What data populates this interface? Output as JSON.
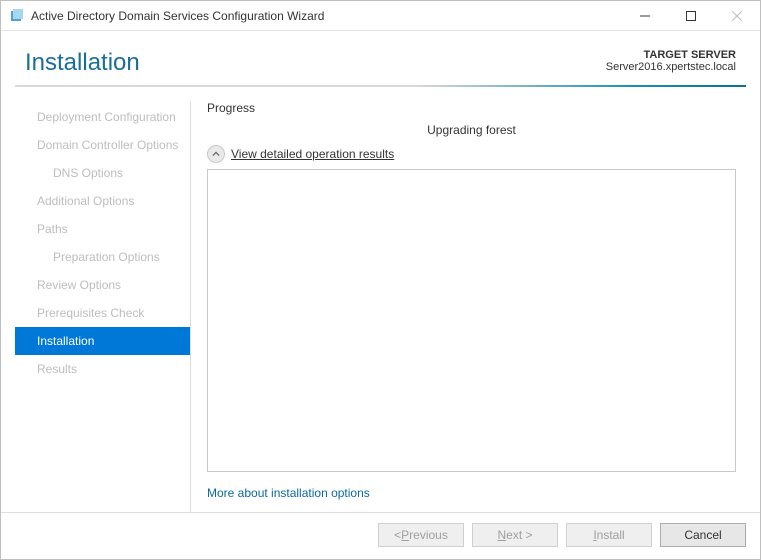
{
  "window": {
    "title": "Active Directory Domain Services Configuration Wizard"
  },
  "header": {
    "page_title": "Installation",
    "target_label": "TARGET SERVER",
    "target_value": "Server2016.xpertstec.local"
  },
  "sidebar": {
    "items": [
      {
        "label": "Deployment Configuration",
        "active": false
      },
      {
        "label": "Domain Controller Options",
        "active": false
      },
      {
        "label": "DNS Options",
        "active": false,
        "sub": true
      },
      {
        "label": "Additional Options",
        "active": false
      },
      {
        "label": "Paths",
        "active": false
      },
      {
        "label": "Preparation Options",
        "active": false,
        "sub": true
      },
      {
        "label": "Review Options",
        "active": false
      },
      {
        "label": "Prerequisites Check",
        "active": false
      },
      {
        "label": "Installation",
        "active": true
      },
      {
        "label": "Results",
        "active": false
      }
    ]
  },
  "main": {
    "progress_label": "Progress",
    "status_text": "Upgrading forest",
    "view_detail_label": "View detailed operation results",
    "more_link": "More about installation options"
  },
  "footer": {
    "previous": "Previous",
    "next": "Next >",
    "install": "Install",
    "cancel": "Cancel"
  }
}
